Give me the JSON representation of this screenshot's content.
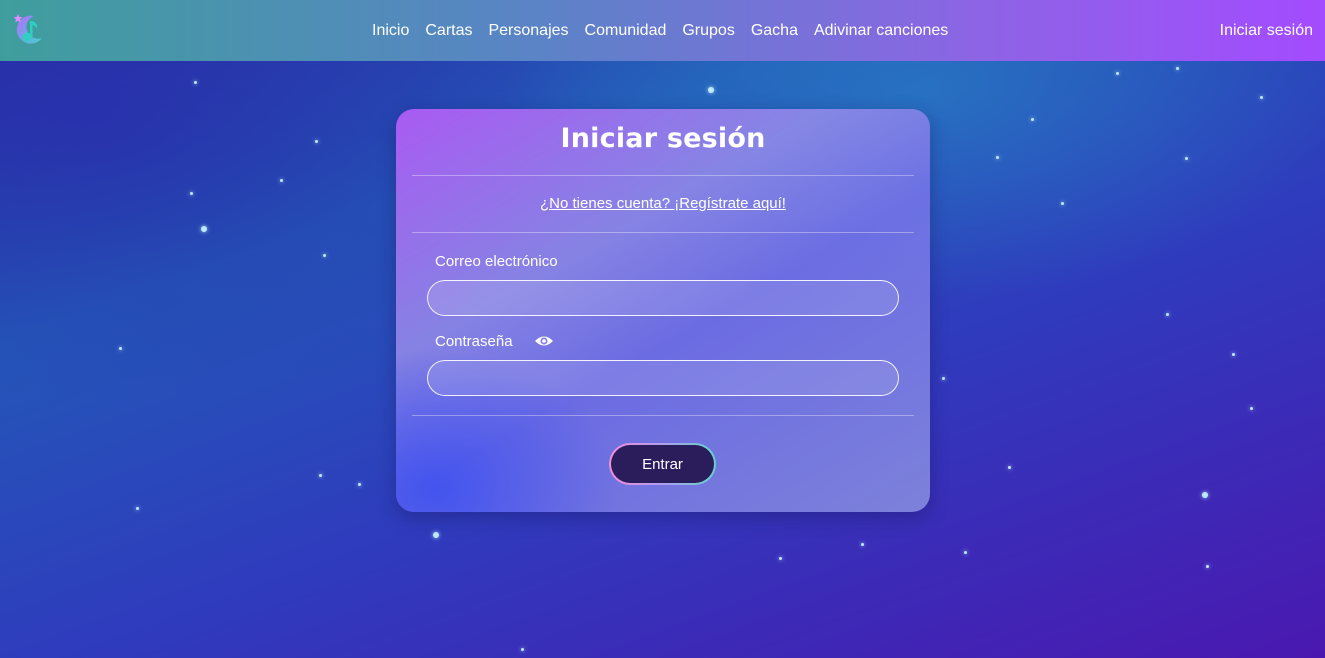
{
  "nav": {
    "links": [
      "Inicio",
      "Cartas",
      "Personajes",
      "Comunidad",
      "Grupos",
      "Gacha",
      "Adivinar canciones"
    ],
    "login": "Iniciar sesión"
  },
  "login_form": {
    "title": "Iniciar sesión",
    "register_link": "¿No tienes cuenta? ¡Regístrate aquí!",
    "email_label": "Correo electrónico",
    "email_value": "",
    "password_label": "Contraseña",
    "password_value": "",
    "submit_label": "Entrar"
  },
  "icons": {
    "logo": "music-note-moon-logo",
    "password_toggle": "eye-icon"
  },
  "colors": {
    "nav_gradient_start": "#3f9e9d",
    "nav_gradient_end": "#a34bff",
    "button_bg": "#2b1c5c",
    "background": "#2f3bbd"
  }
}
